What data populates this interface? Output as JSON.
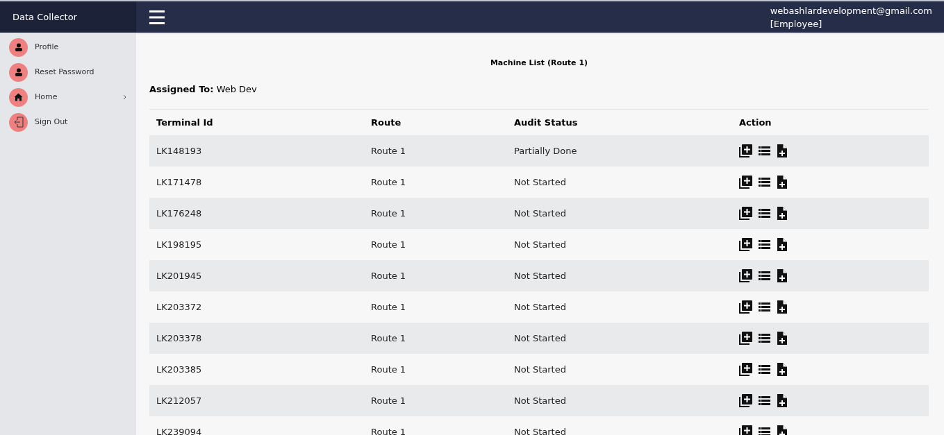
{
  "app_title": "Data Collector",
  "user": {
    "email": "webashlardevelopment@gmail.com",
    "role": "[Employee]"
  },
  "sidebar": {
    "items": [
      {
        "label": "Profile",
        "kind": "user",
        "has_submenu": false
      },
      {
        "label": "Reset Password",
        "kind": "user",
        "has_submenu": false
      },
      {
        "label": "Home",
        "kind": "home",
        "has_submenu": true
      },
      {
        "label": "Sign Out",
        "kind": "signout",
        "has_submenu": false
      }
    ]
  },
  "page_title": "Machine List (Route 1)",
  "assigned": {
    "label": "Assigned To:",
    "value": "Web Dev"
  },
  "table": {
    "columns": [
      "Terminal Id",
      "Route",
      "Audit Status",
      "Action"
    ],
    "rows": [
      {
        "terminal_id": "LK148193",
        "route": "Route 1",
        "audit_status": "Partially Done"
      },
      {
        "terminal_id": "LK171478",
        "route": "Route 1",
        "audit_status": "Not Started"
      },
      {
        "terminal_id": "LK176248",
        "route": "Route 1",
        "audit_status": "Not Started"
      },
      {
        "terminal_id": "LK198195",
        "route": "Route 1",
        "audit_status": "Not Started"
      },
      {
        "terminal_id": "LK201945",
        "route": "Route 1",
        "audit_status": "Not Started"
      },
      {
        "terminal_id": "LK203372",
        "route": "Route 1",
        "audit_status": "Not Started"
      },
      {
        "terminal_id": "LK203378",
        "route": "Route 1",
        "audit_status": "Not Started"
      },
      {
        "terminal_id": "LK203385",
        "route": "Route 1",
        "audit_status": "Not Started"
      },
      {
        "terminal_id": "LK212057",
        "route": "Route 1",
        "audit_status": "Not Started"
      },
      {
        "terminal_id": "LK239094",
        "route": "Route 1",
        "audit_status": "Not Started"
      }
    ]
  }
}
